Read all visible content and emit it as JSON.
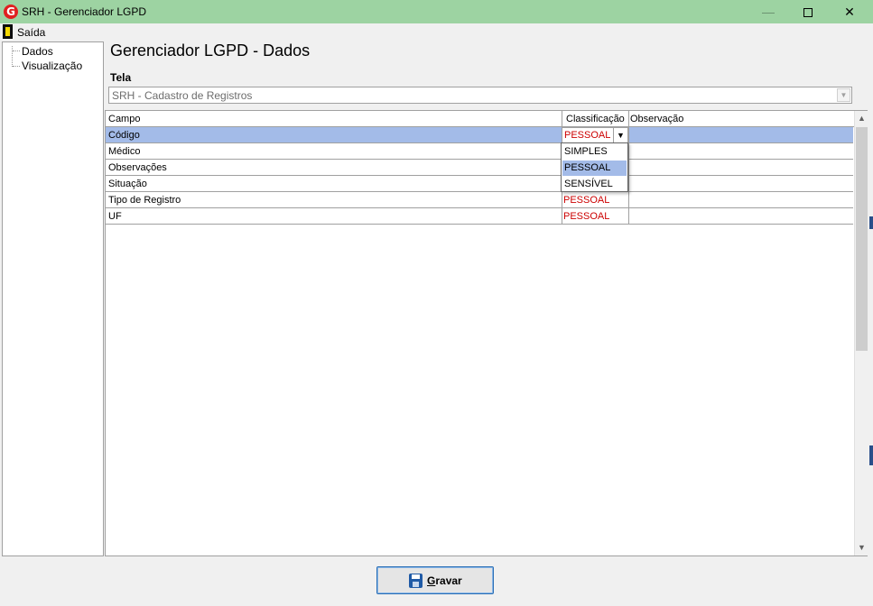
{
  "window": {
    "title": "SRH - Gerenciador LGPD",
    "icon": "G"
  },
  "menu": {
    "exit_label": "Saída"
  },
  "tree": {
    "items": [
      {
        "label": "Dados"
      },
      {
        "label": "Visualização"
      }
    ]
  },
  "main": {
    "title": "Gerenciador LGPD - Dados",
    "tela_label": "Tela",
    "tela_value": "SRH - Cadastro de Registros"
  },
  "grid": {
    "columns": [
      "Campo",
      "Classificação",
      "Observação"
    ],
    "rows": [
      {
        "campo": "Código",
        "classificacao": "PESSOAL",
        "observacao": ""
      },
      {
        "campo": "Médico",
        "classificacao": "",
        "observacao": ""
      },
      {
        "campo": "Observações",
        "classificacao": "",
        "observacao": ""
      },
      {
        "campo": "Situação",
        "classificacao": "",
        "observacao": ""
      },
      {
        "campo": "Tipo de Registro",
        "classificacao": "PESSOAL",
        "observacao": ""
      },
      {
        "campo": "UF",
        "classificacao": "PESSOAL",
        "observacao": ""
      }
    ],
    "selected_row": 0,
    "editor_value": "PESSOAL"
  },
  "dropdown": {
    "options": [
      "SIMPLES",
      "PESSOAL",
      "SENSÍVEL"
    ],
    "highlighted": "PESSOAL"
  },
  "footer": {
    "save_label_first": "G",
    "save_label_rest": "ravar"
  },
  "colors": {
    "titlebar": "#9dd3a2",
    "selection": "#a3bbe8",
    "classification_text": "#cc0000"
  }
}
